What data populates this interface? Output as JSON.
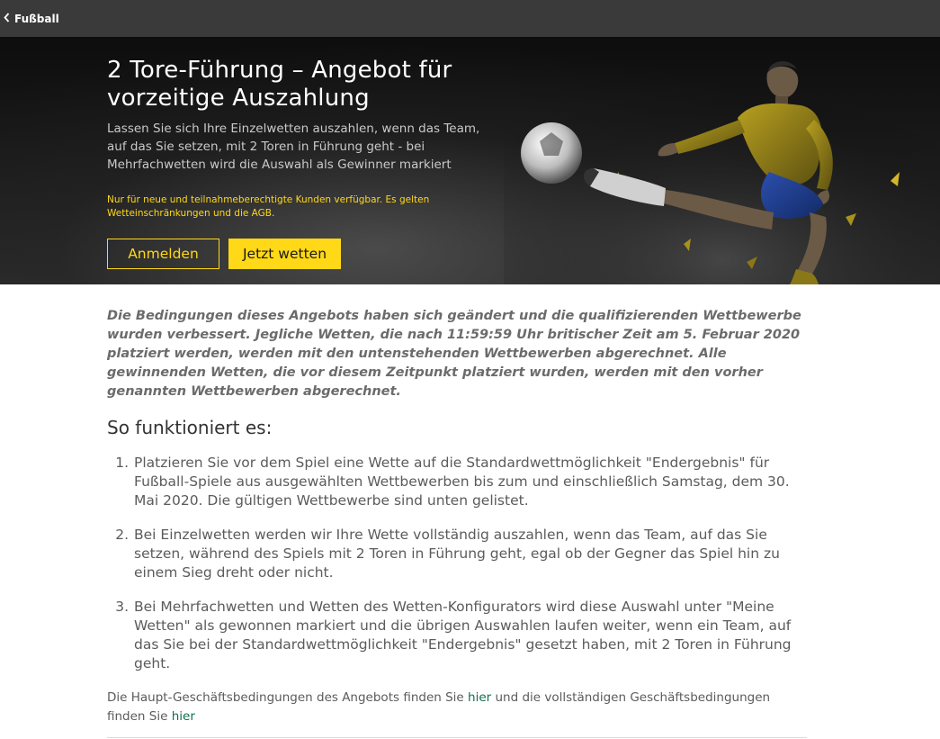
{
  "topbar": {
    "back_label": "Fußball",
    "back_icon": "chevron-left-icon"
  },
  "hero": {
    "title": "2 Tore-Führung – Angebot für vorzeitige Auszahlung",
    "subtitle": "Lassen Sie sich Ihre Einzelwetten auszahlen, wenn das Team, auf das Sie setzen, mit 2 Toren in Führung geht - bei Mehrfachwetten wird die Auswahl als Gewinner markiert",
    "legal": "Nur für neue und teilnahmeberechtigte Kunden verfügbar. Es gelten Wetteinschränkungen und die AGB.",
    "login_label": "Anmelden",
    "bet_label": "Jetzt wetten",
    "accent_color": "#ffd817"
  },
  "main": {
    "notice": "Die Bedingungen dieses Angebots haben sich geändert und die qualifizierenden Wettbewerbe wurden verbessert. Jegliche Wetten, die nach 11:59:59 Uhr britischer Zeit am 5. Februar 2020 platziert werden, werden mit den untenstehenden Wettbewerben abgerechnet. Alle gewinnenden Wetten, die vor diesem Zeitpunkt platziert wurden, werden mit den vorher genannten Wettbewerben abgerechnet.",
    "steps_title": "So funktioniert es:",
    "steps": [
      "Platzieren Sie vor dem Spiel eine Wette auf die Standardwettmöglichkeit \"Endergebnis\" für Fußball-Spiele aus ausgewählten Wettbewerben bis zum und einschließlich Samstag, dem 30. Mai 2020. Die gültigen Wettbewerbe sind unten gelistet.",
      "Bei Einzelwetten werden wir Ihre Wette vollständig auszahlen, wenn das Team, auf das Sie setzen, während des Spiels mit 2 Toren in Führung geht, egal ob der Gegner das Spiel hin zu einem Sieg dreht oder nicht.",
      "Bei Mehrfachwetten und Wetten des Wetten-Konfigurators wird diese Auswahl unter \"Meine Wetten\" als gewonnen markiert und die übrigen Auswahlen laufen weiter, wenn ein Team, auf das Sie bei der Standardwettmöglichkeit \"Endergebnis\" gesetzt haben, mit 2 Toren in Führung geht."
    ],
    "footer": {
      "text_before": "Die Haupt-Geschäftsbedingungen des Angebots finden Sie ",
      "link1": "hier",
      "text_middle": " und die vollständigen Geschäftsbedingungen finden Sie ",
      "link2": "hier",
      "link_color": "#126e51"
    }
  }
}
